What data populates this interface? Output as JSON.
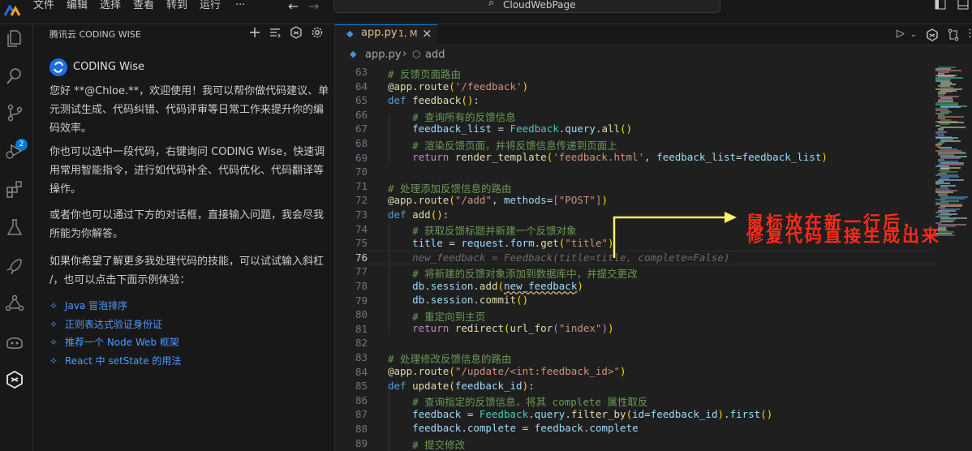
{
  "titlebar": {
    "menus": [
      "文件",
      "编辑",
      "选择",
      "查看",
      "转到",
      "运行",
      "···"
    ],
    "search_text": "CloudWebPage"
  },
  "activity": {
    "scm_badge": "2"
  },
  "sidebar": {
    "title": "腾讯云 CODING WISE",
    "assistant_name": "CODING Wise",
    "greeting_lines": [
      "您好 **@Chloe.**，欢迎使用！我可以帮你做代码建议、单",
      "元测试生成、代码纠错、代码评审等日常工作来提升你的编",
      "码效率。"
    ],
    "para2_lines": [
      "你也可以选中一段代码，右键询问 CODING Wise，快速调",
      "用常用智能指令，进行如代码补全、代码优化、代码翻译等",
      "操作。"
    ],
    "para3_lines": [
      "或者你也可以通过下方的对话框，直接输入问题，我会尽我",
      "所能为你解答。"
    ],
    "para4_lines": [
      "如果你希望了解更多我处理代码的技能，可以试试输入斜杠",
      "/，也可以点击下面示例体验："
    ],
    "examples": [
      "Java 冒泡排序",
      "正则表达式验证身份证",
      "推荐一个 Node Web 框架",
      "React 中 setState 的用法"
    ]
  },
  "editor": {
    "tab_name": "app.py",
    "tab_status": "1, M",
    "breadcrumb_file": "app.py",
    "breadcrumb_symbol": "add",
    "current_line": 76,
    "line_numbers": [
      "63",
      "64",
      "65",
      "66",
      "67",
      "68",
      "69",
      "70",
      "71",
      "72",
      "73",
      "74",
      "75",
      "76",
      "77",
      "78",
      "79",
      "80",
      "81",
      "82",
      "83",
      "84",
      "85",
      "86",
      "87",
      "88",
      "89"
    ]
  },
  "annotation": {
    "line1": "鼠标放在新一行后，",
    "line2": "修复代码直接生成出来"
  },
  "colors": {
    "annotation_red": "#ff2a1a",
    "annotation_yellow": "#fff46b",
    "accent": "#0078d4",
    "link": "#4b9cff"
  }
}
